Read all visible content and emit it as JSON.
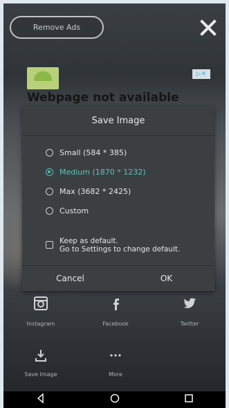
{
  "top": {
    "remove_ads_label": "Remove Ads"
  },
  "ad": {
    "title": "Webpage not available"
  },
  "dialog": {
    "title": "Save Image",
    "options": [
      {
        "label": "Small (584 * 385)",
        "selected": false
      },
      {
        "label": "Medium (1870 * 1232)",
        "selected": true
      },
      {
        "label": "Max (3682 * 2425)",
        "selected": false
      },
      {
        "label": "Custom",
        "selected": false
      }
    ],
    "checkbox": {
      "line1": "Keep as default.",
      "line2": "Go to Settings to change default.",
      "checked": false
    },
    "cancel_label": "Cancel",
    "ok_label": "OK"
  },
  "share": {
    "items": [
      {
        "label": "Instagram",
        "icon": "instagram-icon"
      },
      {
        "label": "Facebook",
        "icon": "facebook-icon"
      },
      {
        "label": "Twitter",
        "icon": "twitter-icon"
      },
      {
        "label": "Save Image",
        "icon": "download-icon"
      },
      {
        "label": "More",
        "icon": "more-dots-icon"
      }
    ]
  },
  "colors": {
    "accent": "#4fc3b2",
    "dialog_bg": "#3c3f42",
    "text": "#e6e6e6"
  }
}
